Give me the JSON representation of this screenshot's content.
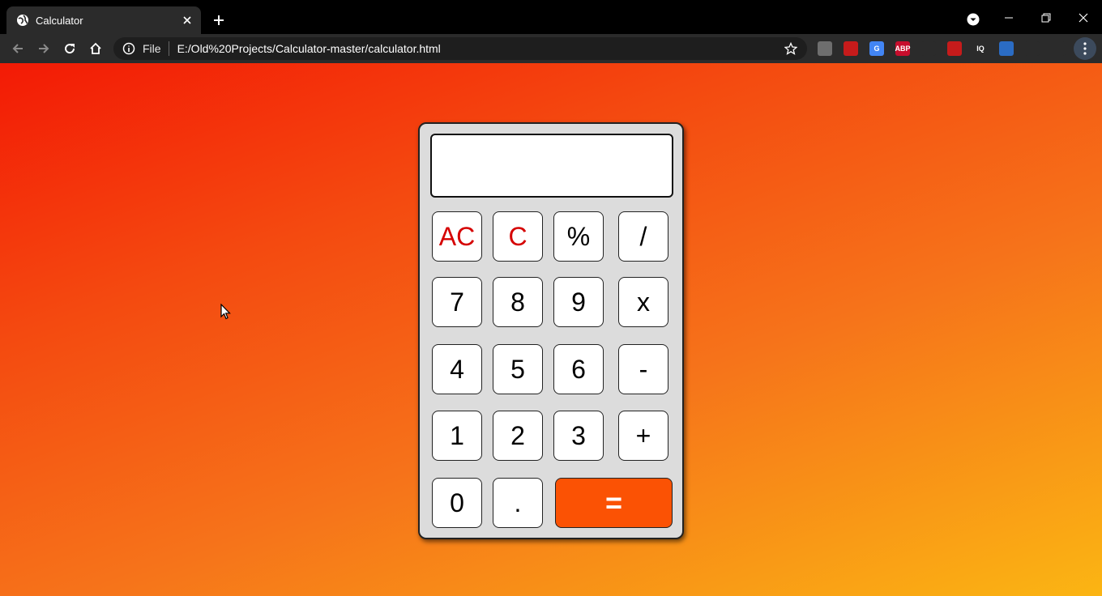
{
  "browser": {
    "tab_title": "Calculator",
    "scheme_label": "File",
    "url": "E:/Old%20Projects/Calculator-master/calculator.html",
    "extensions": [
      {
        "name": "ext-1-icon",
        "text": "",
        "color": "#6e6e6e"
      },
      {
        "name": "ext-2-icon",
        "text": "",
        "color": "#c61b1b"
      },
      {
        "name": "google-translate-icon",
        "text": "G",
        "color": "#4285f4"
      },
      {
        "name": "adblock-plus-icon",
        "text": "ABP",
        "color": "#c70d2c"
      },
      {
        "name": "lightbulb-icon",
        "text": "",
        "color": "#2b2b2b"
      },
      {
        "name": "chart-icon",
        "text": "",
        "color": "#c61b1b"
      },
      {
        "name": "iq-icon",
        "text": "IQ",
        "color": "#2b2b2b"
      },
      {
        "name": "robot-icon",
        "text": "",
        "color": "#2b6cc4"
      },
      {
        "name": "puzzle-icon",
        "text": "",
        "color": "#2b2b2b"
      },
      {
        "name": "mascot-icon",
        "text": "",
        "color": "#2b2b2b"
      }
    ]
  },
  "calculator": {
    "display_value": "",
    "keys": {
      "ac": "AC",
      "c": "C",
      "percent": "%",
      "divide": "/",
      "seven": "7",
      "eight": "8",
      "nine": "9",
      "multiply": "x",
      "four": "4",
      "five": "5",
      "six": "6",
      "minus": "-",
      "one": "1",
      "two": "2",
      "three": "3",
      "plus": "+",
      "zero": "0",
      "dot": ".",
      "equals": "="
    },
    "colors": {
      "red_text": "#d50000",
      "equals_bg": "#fb5204",
      "body_bg": "#dcdcdc"
    }
  }
}
